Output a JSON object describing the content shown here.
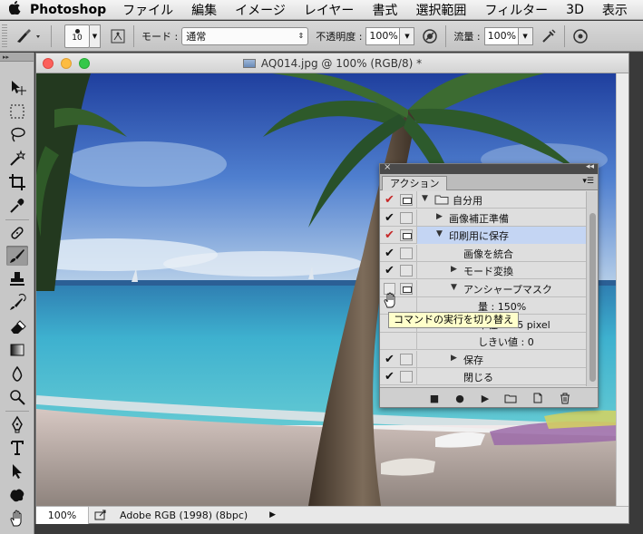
{
  "menubar": {
    "app_name": "Photoshop",
    "items": [
      "ファイル",
      "編集",
      "イメージ",
      "レイヤー",
      "書式",
      "選択範囲",
      "フィルター",
      "3D",
      "表示"
    ]
  },
  "options_bar": {
    "brush_size": "10",
    "mode_label": "モード :",
    "mode_value": "通常",
    "opacity_label": "不透明度 :",
    "opacity_value": "100%",
    "flow_label": "流量 :",
    "flow_value": "100%"
  },
  "document": {
    "title": "AQ014.jpg @ 100% (RGB/8) *",
    "zoom": "100%",
    "profile": "Adobe RGB (1998) (8bpc)"
  },
  "actions_panel": {
    "tab_label": "アクション",
    "rows": [
      {
        "label": "自分用",
        "check": "red",
        "dialog": true,
        "triangle": "down",
        "folder": true,
        "indent": 0
      },
      {
        "label": "画像補正準備",
        "check": "black",
        "dialog": false,
        "triangle": "right",
        "indent": 1
      },
      {
        "label": "印刷用に保存",
        "check": "red",
        "dialog": true,
        "triangle": "down",
        "indent": 1,
        "selected": true
      },
      {
        "label": "画像を統合",
        "check": "black",
        "dialog": false,
        "triangle": "",
        "indent": 2
      },
      {
        "label": "モード変換",
        "check": "black",
        "dialog": false,
        "triangle": "right",
        "indent": 2
      },
      {
        "label": "アンシャープマスク",
        "check": "none",
        "dialog": true,
        "triangle": "down",
        "indent": 2
      },
      {
        "label": "量 : 150%",
        "check": "",
        "dialog": false,
        "triangle": "",
        "indent": 3
      },
      {
        "label": "半径 : 0.5 pixel",
        "check": "",
        "dialog": false,
        "triangle": "",
        "indent": 3
      },
      {
        "label": "しきい値 : 0",
        "check": "",
        "dialog": false,
        "triangle": "",
        "indent": 3
      },
      {
        "label": "保存",
        "check": "black",
        "dialog": false,
        "triangle": "right",
        "indent": 2
      },
      {
        "label": "閉じる",
        "check": "black",
        "dialog": false,
        "triangle": "",
        "indent": 2
      }
    ]
  },
  "tooltip": "コマンドの実行を切り替え",
  "colors": {
    "check_red": "#c62828",
    "selection": "#c4d5f3",
    "tooltip_bg": "#ffffcb"
  }
}
